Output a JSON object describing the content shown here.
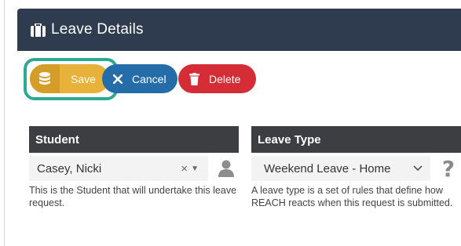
{
  "header": {
    "title": "Leave Details",
    "icon": "briefcase-icon"
  },
  "toolbar": {
    "save_label": "Save",
    "cancel_label": "Cancel",
    "delete_label": "Delete"
  },
  "student": {
    "label": "Student",
    "value": "Casey, Nicki",
    "clear_symbol": "×",
    "caret_symbol": "▼",
    "help": "This is the Student that will undertake this leave request."
  },
  "leave_type": {
    "label": "Leave Type",
    "value": "Weekend Leave - Home",
    "help_symbol": "?",
    "help": "A leave type is a set of rules that define how REACH reacts when this request is submitted."
  },
  "colors": {
    "header": "#2f3b4e",
    "save": "#e8b23a",
    "cancel": "#246da8",
    "delete": "#d42d36",
    "focus_ring": "#2fa891",
    "field_header": "#3c3e42"
  }
}
